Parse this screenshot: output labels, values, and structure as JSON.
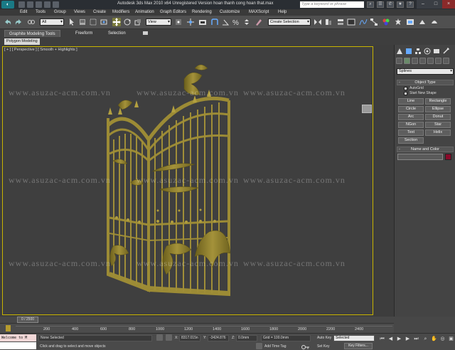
{
  "titlebar": {
    "title": "Autodesk 3ds Max  2010 x64     Unregistered Version     hoan thanh cong hoan that.max",
    "search_placeholder": "Type a keyword or phrase"
  },
  "menu": [
    "Edit",
    "Tools",
    "Group",
    "Views",
    "Create",
    "Modifiers",
    "Animation",
    "Graph Editors",
    "Rendering",
    "Customize",
    "MAXScript",
    "Help"
  ],
  "toolbar": {
    "selection_filter": "All",
    "coord_system": "View",
    "named_selection": "Create Selection"
  },
  "ribbon": {
    "tabs": [
      "Graphite Modeling Tools",
      "Freeform",
      "Selection"
    ],
    "sub_tab": "Polygon Modeling"
  },
  "viewport": {
    "label": "[ + ] [ Perspective ] [ Smooth + Highlights ]",
    "watermark": "www.asuzac-acm.com.vn"
  },
  "command_panel": {
    "category": "Splines",
    "object_type_title": "Object Type",
    "autogrid": "AutoGrid",
    "start_new_shape": "Start New Shape",
    "buttons": [
      "Line",
      "Rectangle",
      "Circle",
      "Ellipse",
      "Arc",
      "Donut",
      "NGon",
      "Star",
      "Text",
      "Helix",
      "Section"
    ],
    "name_color_title": "Name and Color",
    "color": "#8a0a2a"
  },
  "timeline": {
    "frame": "0 / 2500",
    "ticks": [
      "200",
      "400",
      "600",
      "800",
      "1000",
      "1200",
      "1400",
      "1600",
      "1800",
      "2000",
      "2200",
      "2400"
    ]
  },
  "status": {
    "listener": "Welcome to M",
    "selection": "None Selected",
    "prompt": "Click and drag to select and move objects",
    "x_label": "X:",
    "x_value": "8317.015n",
    "y_label": "Y:",
    "y_value": "-3424.876",
    "z_label": "Z:",
    "z_value": "0.0mm",
    "grid": "Grid = 100.0mm",
    "add_time_tag": "Add Time Tag",
    "auto_key": "Auto Key",
    "set_key": "Set Key",
    "key_mode": "Selected",
    "key_filters": "Key Filters..."
  }
}
